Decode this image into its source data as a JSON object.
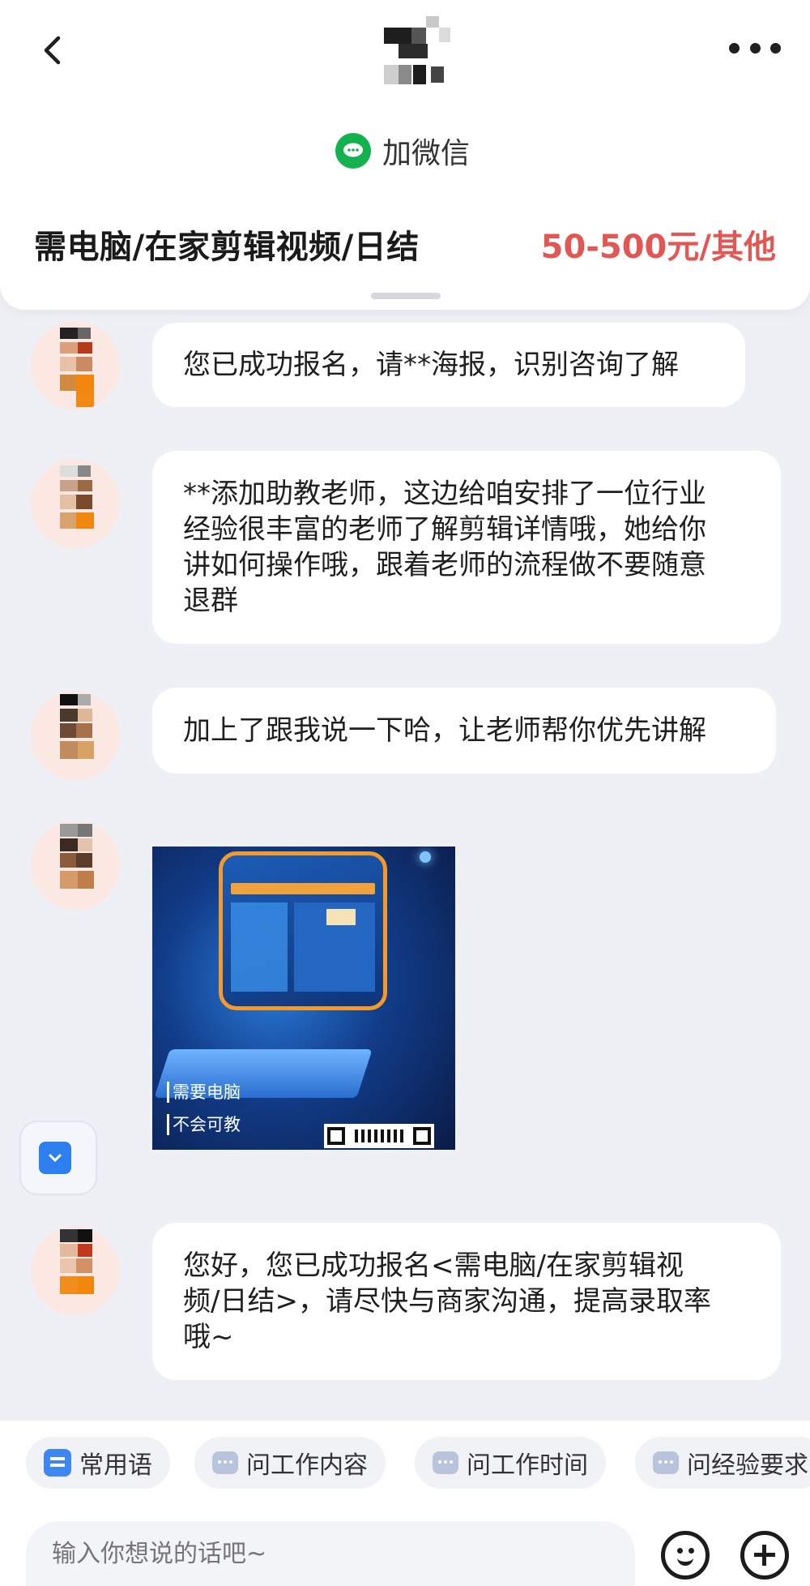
{
  "header": {
    "wechat_label": "加微信",
    "job_title": "需电脑/在家剪辑视频/日结",
    "salary": "50-500元/其他"
  },
  "messages": [
    {
      "type": "text",
      "text": "您已成功报名，请**海报，识别咨询了解"
    },
    {
      "type": "text",
      "text": "**添加助教老师，这边给咱安排了一位行业\n经验很丰富的老师了解剪辑详情哦，她给你\n讲如何操作哦，跟着老师的流程做不要随意\n退群"
    },
    {
      "type": "text",
      "text": "加上了跟我说一下哈，让老师帮你优先讲解"
    },
    {
      "type": "image",
      "image_tags": [
        "需要电脑",
        "不会可教"
      ]
    },
    {
      "type": "text",
      "text": "您好，您已成功报名<需电脑/在家剪辑视\n频/日结>，请尽快与商家沟通，提高录取率\n哦~"
    }
  ],
  "quick_replies": [
    "常用语",
    "问工作内容",
    "问工作时间",
    "问经验要求"
  ],
  "input": {
    "placeholder": "输入你想说的话吧~"
  },
  "icons": {
    "back": "chevron-left-icon",
    "more": "more-dots-icon",
    "wechat": "wechat-icon",
    "emoji": "emoji-icon",
    "plus": "plus-icon"
  },
  "colors": {
    "salary": "#e25653",
    "wechat_green": "#14b14f",
    "background": "#eef0f6"
  }
}
